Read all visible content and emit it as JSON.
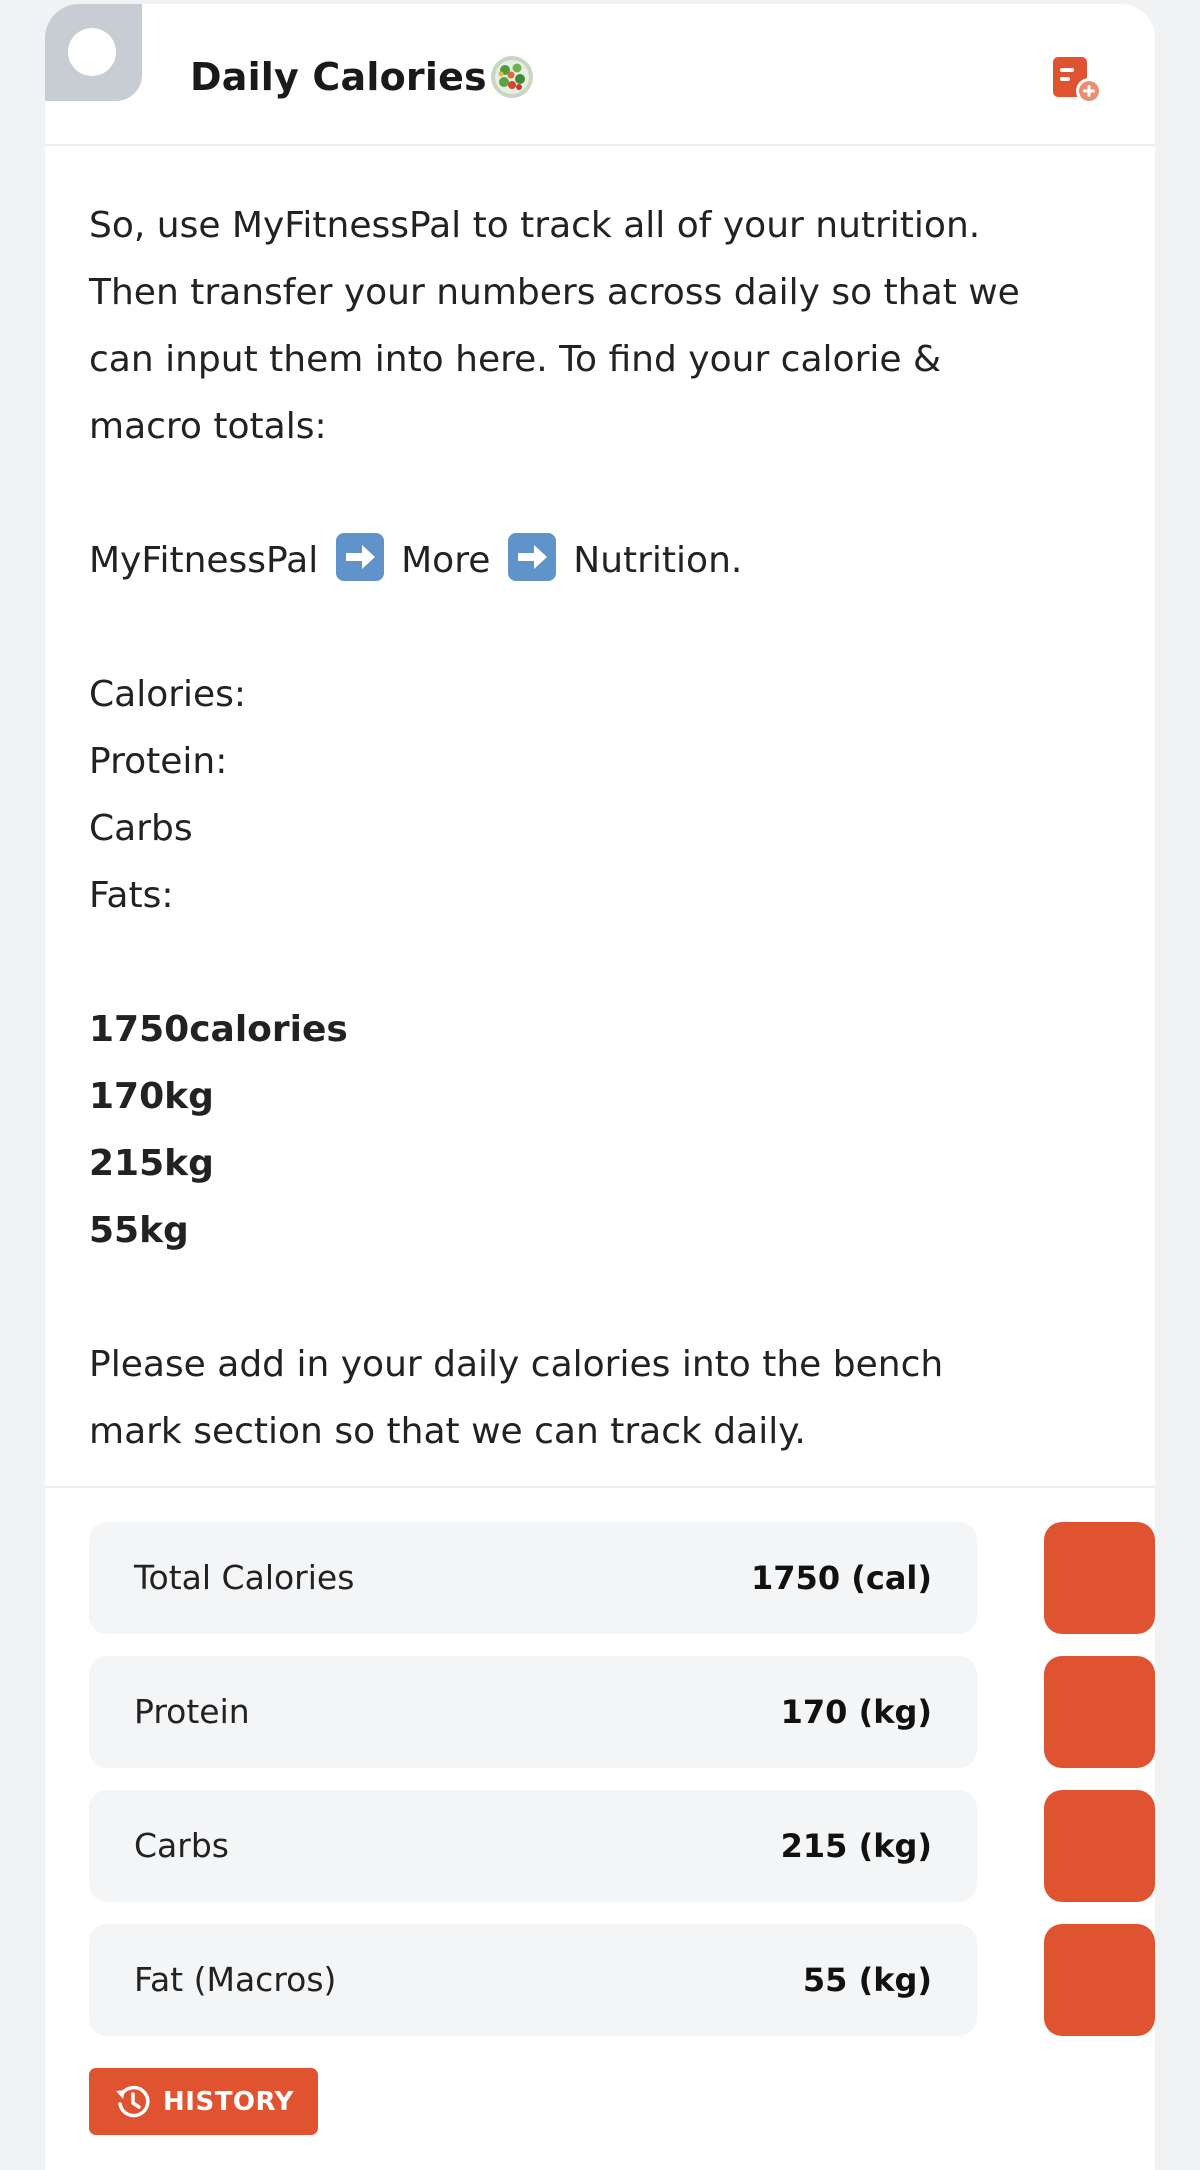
{
  "header": {
    "title": "Daily Calories",
    "title_icon": "salad-emoji-icon",
    "action_icon": "add-note-icon"
  },
  "content": {
    "intro_lines": [
      "So, use MyFitnessPal to track all of your nutrition.",
      "Then transfer your numbers across daily so that we",
      "can input them into here. To find your calorie &",
      "macro totals:"
    ],
    "path": {
      "step1": "MyFitnessPal",
      "step2": "More",
      "step3": "Nutrition.",
      "separator_icon": "right-arrow-emoji-icon"
    },
    "labels": [
      "Calories:",
      "Protein:",
      "Carbs",
      "Fats:"
    ],
    "targets": [
      "1750calories",
      "170kg",
      "215kg",
      "55kg"
    ],
    "outro_lines": [
      "Please add in your daily calories into the bench",
      "mark section so that we can track daily."
    ]
  },
  "metrics": [
    {
      "label": "Total Calories",
      "value": "1750 (cal)"
    },
    {
      "label": "Protein",
      "value": "170 (kg)"
    },
    {
      "label": "Carbs",
      "value": "215 (kg)"
    },
    {
      "label": "Fat (Macros)",
      "value": "55 (kg)"
    }
  ],
  "history_button": {
    "label": "HISTORY",
    "icon": "history-icon"
  },
  "colors": {
    "accent": "#e05330",
    "page_bg": "#f1f2f4",
    "card_bg": "#ffffff",
    "metric_bg": "#f4f5f7",
    "arrow_emoji_bg": "#5f93c9"
  }
}
